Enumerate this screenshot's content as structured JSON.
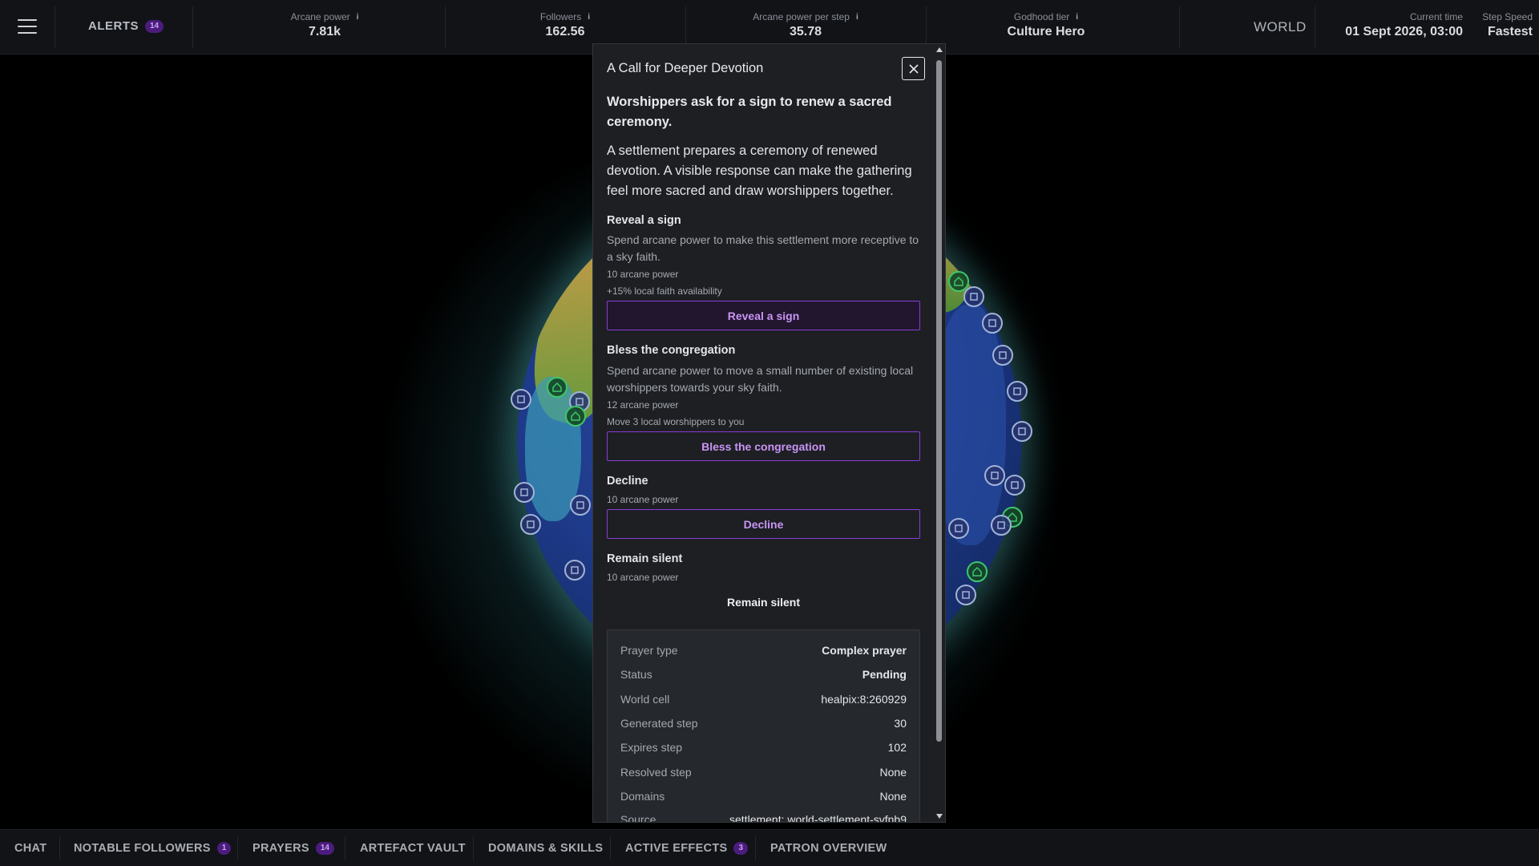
{
  "topbar": {
    "alerts_label": "ALERTS",
    "alerts_count": "14",
    "stats": [
      {
        "label": "Arcane power",
        "value": "7.81k"
      },
      {
        "label": "Followers",
        "value": "162.56"
      },
      {
        "label": "Arcane power per step",
        "value": "35.78"
      },
      {
        "label": "Godhood tier",
        "value": "Culture Hero"
      }
    ],
    "info_glyph": "i",
    "world_label": "WORLD",
    "current_time_label": "Current time",
    "current_time_value": "01 Sept 2026, 03:00",
    "step_speed_label": "Step Speed",
    "step_speed_value": "Fastest"
  },
  "modal": {
    "title": "A Call for Deeper Devotion",
    "headline": "Worshippers ask for a sign to renew a sacred ceremony.",
    "description": "A settlement prepares a ceremony of renewed devotion. A visible response can make the gathering feel more sacred and draw worshippers together.",
    "options": [
      {
        "title": "Reveal a sign",
        "desc": "Spend arcane power to make this settlement more receptive to a sky faith.",
        "cost": "10 arcane power",
        "effect": "+15% local faith availability",
        "button": "Reveal a sign"
      },
      {
        "title": "Bless the congregation",
        "desc": "Spend arcane power to move a small number of existing local worshippers towards your sky faith.",
        "cost": "12 arcane power",
        "effect": "Move 3 local worshippers to you",
        "button": "Bless the congregation"
      },
      {
        "title": "Decline",
        "cost": "10 arcane power",
        "button": "Decline"
      },
      {
        "title": "Remain silent",
        "cost": "10 arcane power",
        "button": "Remain silent"
      }
    ],
    "details": [
      {
        "key": "Prayer type",
        "value": "Complex prayer"
      },
      {
        "key": "Status",
        "value": "Pending"
      },
      {
        "key": "World cell",
        "value": "healpix:8:260929"
      },
      {
        "key": "Generated step",
        "value": "30"
      },
      {
        "key": "Expires step",
        "value": "102"
      },
      {
        "key": "Resolved step",
        "value": "None"
      },
      {
        "key": "Domains",
        "value": "None"
      },
      {
        "key": "Source",
        "value": "settlement: world-settlement-svfnb9"
      }
    ]
  },
  "bottombar": {
    "tabs": [
      {
        "label": "CHAT"
      },
      {
        "label": "NOTABLE FOLLOWERS",
        "count": "1"
      },
      {
        "label": "PRAYERS",
        "count": "14"
      },
      {
        "label": "ARTEFACT VAULT"
      },
      {
        "label": "DOMAINS & SKILLS"
      },
      {
        "label": "ACTIVE EFFECTS",
        "count": "3"
      },
      {
        "label": "PATRON OVERVIEW"
      }
    ]
  },
  "colors": {
    "accent": "#8a3bd6",
    "accent_text": "#c994f5",
    "badge_bg": "#4b1c7c",
    "ocean": "#1e3a8a",
    "settlement_marker": "#3fc76a",
    "shrine_marker": "#9fb4d8"
  },
  "icons": [
    "hamburger-icon",
    "info-icon",
    "close-icon",
    "temple-marker-icon",
    "home-marker-icon"
  ]
}
